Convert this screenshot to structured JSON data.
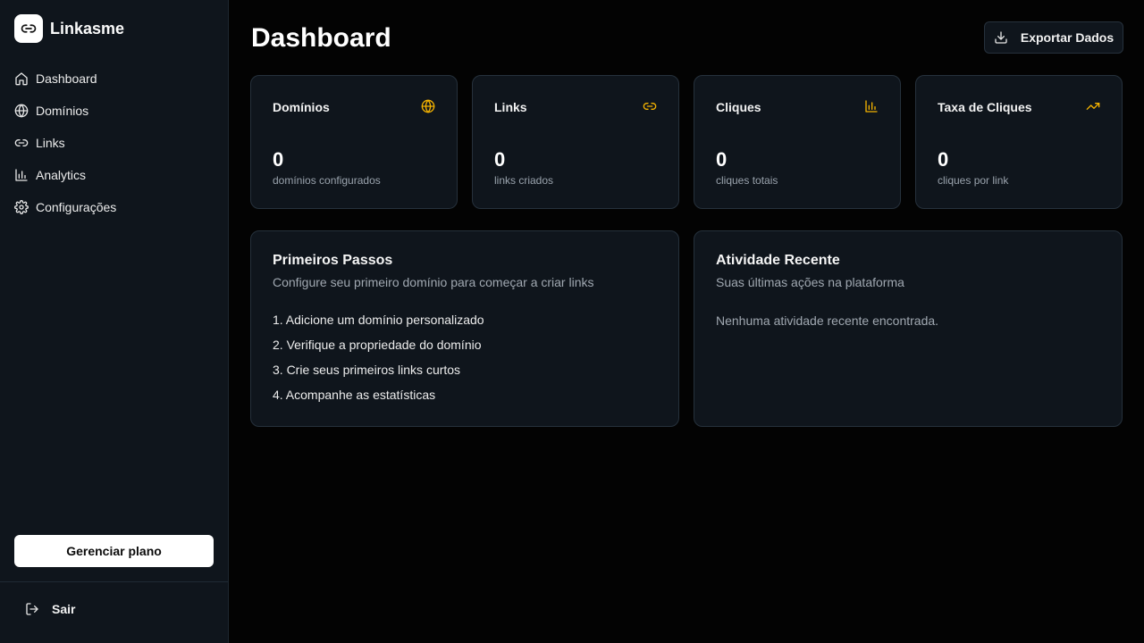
{
  "brand": {
    "name": "Linkasme"
  },
  "nav": {
    "items": [
      {
        "label": "Dashboard",
        "icon": "home-icon"
      },
      {
        "label": "Domínios",
        "icon": "globe-icon"
      },
      {
        "label": "Links",
        "icon": "link-icon"
      },
      {
        "label": "Analytics",
        "icon": "bar-chart-icon"
      },
      {
        "label": "Configurações",
        "icon": "gear-icon"
      }
    ]
  },
  "sidebar": {
    "plan_button": "Gerenciar plano",
    "logout_label": "Sair"
  },
  "header": {
    "title": "Dashboard",
    "export_label": "Exportar Dados"
  },
  "stats": [
    {
      "title": "Domínios",
      "value": "0",
      "sub": "domínios configurados",
      "icon": "globe-icon"
    },
    {
      "title": "Links",
      "value": "0",
      "sub": "links criados",
      "icon": "link-icon"
    },
    {
      "title": "Cliques",
      "value": "0",
      "sub": "cliques totais",
      "icon": "bar-chart-icon"
    },
    {
      "title": "Taxa de Cliques",
      "value": "0",
      "sub": "cliques por link",
      "icon": "trending-up-icon"
    }
  ],
  "getting_started": {
    "title": "Primeiros Passos",
    "subtitle": "Configure seu primeiro domínio para começar a criar links",
    "steps": [
      "1. Adicione um domínio personalizado",
      "2. Verifique a propriedade do domínio",
      "3. Crie seus primeiros links curtos",
      "4. Acompanhe as estatísticas"
    ]
  },
  "recent_activity": {
    "title": "Atividade Recente",
    "subtitle": "Suas últimas ações na plataforma",
    "empty_text": "Nenhuma atividade recente encontrada."
  },
  "colors": {
    "accent": "#f5b300",
    "background": "#030303",
    "card": "#0f151c",
    "border": "#26313c"
  }
}
